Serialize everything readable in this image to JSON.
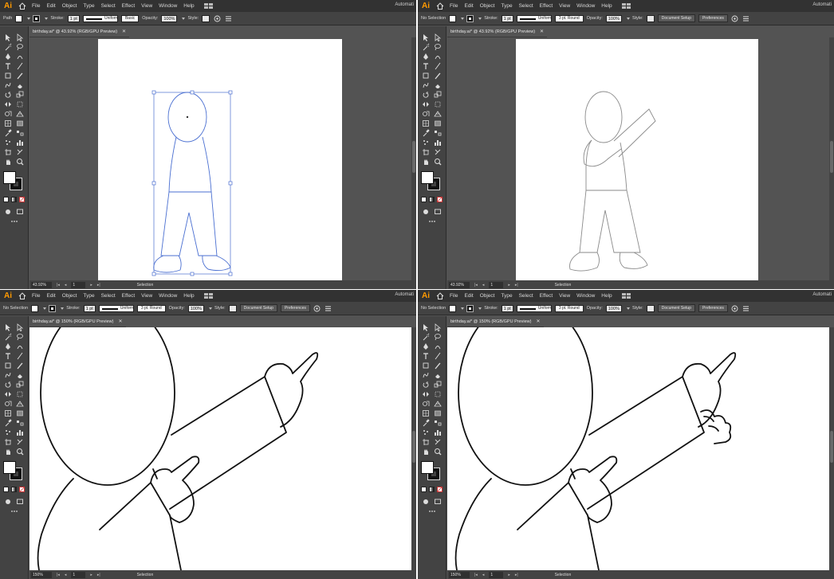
{
  "app": {
    "logo": "Ai",
    "menus": [
      "File",
      "Edit",
      "Object",
      "Type",
      "Select",
      "Effect",
      "View",
      "Window",
      "Help"
    ],
    "workspace": "Automati"
  },
  "panels": [
    {
      "control": {
        "selection": "Path",
        "stroke_label": "Stroke:",
        "stroke_weight": "1 pt",
        "profile": "Uniform",
        "brush": "Basic",
        "opacity_label": "Opacity:",
        "opacity": "100%",
        "style_label": "Style:",
        "cap": "",
        "doc_setup": "",
        "prefs": ""
      },
      "tab_title": "birthday.ai* @ 43.92% (RGB/GPU Preview)",
      "zoom": "43.92%",
      "page": "1",
      "status": "Selection"
    },
    {
      "control": {
        "selection": "No Selection",
        "stroke_label": "Stroke:",
        "stroke_weight": "1 pt",
        "profile": "Uniform",
        "brush": "",
        "opacity_label": "Opacity:",
        "opacity": "100%",
        "style_label": "Style:",
        "cap": "3 pt. Round",
        "doc_setup": "Document Setup",
        "prefs": "Preferences"
      },
      "tab_title": "birthday.ai* @ 43.92% (RGB/GPU Preview)",
      "zoom": "43.92%",
      "page": "1",
      "status": "Selection"
    },
    {
      "control": {
        "selection": "No Selection",
        "stroke_label": "Stroke:",
        "stroke_weight": "1 pt",
        "profile": "Uniform",
        "brush": "",
        "opacity_label": "Opacity:",
        "opacity": "100%",
        "style_label": "Style:",
        "cap": "3 pt. Round",
        "doc_setup": "Document Setup",
        "prefs": "Preferences"
      },
      "tab_title": "birthday.ai* @ 150% (RGB/GPU Preview)",
      "zoom": "150%",
      "page": "1",
      "status": "Selection"
    },
    {
      "control": {
        "selection": "No Selection",
        "stroke_label": "Stroke:",
        "stroke_weight": "1 pt",
        "profile": "Uniform",
        "brush": "",
        "opacity_label": "Opacity:",
        "opacity": "100%",
        "style_label": "Style:",
        "cap": "3 pt. Round",
        "doc_setup": "Document Setup",
        "prefs": "Preferences"
      },
      "tab_title": "birthday.ai* @ 150% (RGB/GPU Preview)",
      "zoom": "150%",
      "page": "1",
      "status": "Selection"
    }
  ],
  "tool_icons": [
    "selection-tool-icon",
    "direct-selection-tool-icon",
    "magic-wand-icon",
    "lasso-icon",
    "pen-tool-icon",
    "curvature-tool-icon",
    "type-tool-icon",
    "line-tool-icon",
    "rectangle-tool-icon",
    "paintbrush-icon",
    "shaper-tool-icon",
    "eraser-icon",
    "rotate-tool-icon",
    "scale-tool-icon",
    "width-tool-icon",
    "free-transform-icon",
    "shape-builder-icon",
    "perspective-grid-icon",
    "mesh-tool-icon",
    "gradient-tool-icon",
    "eyedropper-icon",
    "blend-tool-icon",
    "symbol-sprayer-icon",
    "column-graph-icon",
    "artboard-tool-icon",
    "slice-tool-icon",
    "hand-tool-icon",
    "zoom-tool-icon"
  ],
  "colors": {
    "selection_blue": "#4a6fd1",
    "outline_gray": "#8a8a8a",
    "outline_black": "#111111",
    "app_dark": "#323232",
    "app_mid": "#434343",
    "canvas_bg": "#535353"
  }
}
